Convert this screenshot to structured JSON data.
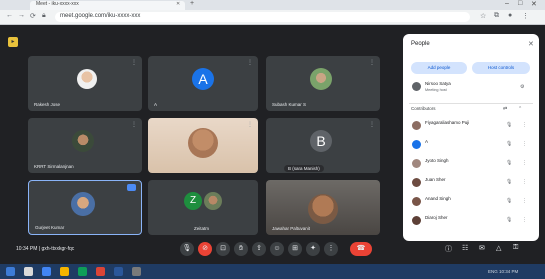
{
  "browser": {
    "tab_title": "Meet - iku-xxxx-xxx",
    "url": "meet.google.com/iku-xxxx-xxx"
  },
  "tiles": [
    {
      "name": "Rakesh Jose"
    },
    {
      "name": "A",
      "letter": "A"
    },
    {
      "name": "Subash Kumar S"
    },
    {
      "name": "KRRT Sirmalanjnan"
    },
    {
      "name": ""
    },
    {
      "name": "",
      "letter": "B"
    },
    {
      "name": "Gurjeet Kumar",
      "pinned": true
    },
    {
      "name": "Zeitatm",
      "letter": "Z"
    },
    {
      "name": "Jawahar Paltuvanit"
    }
  ],
  "camera_pill": "B (sara Manish)",
  "footer": {
    "time": "10:34 PM",
    "separator": "|",
    "meeting_code": "gxh-ttxxkgr-fqc"
  },
  "people_panel": {
    "title": "People",
    "add_people": "Add people",
    "host_controls": "Host controls",
    "section": "Contributors",
    "host": {
      "name": "Nirsoo Satya",
      "sub": "Meeting host"
    },
    "rows": [
      {
        "name": "Fiyagaraliashamo Puji",
        "sub": "",
        "color": "#8d6e63"
      },
      {
        "name": "A",
        "sub": "",
        "color": "#1a73e8"
      },
      {
        "name": "Jyoto Singh",
        "sub": "",
        "color": "#a1887f"
      },
      {
        "name": "Juan Sher",
        "sub": "",
        "color": "#6d4c41"
      },
      {
        "name": "Anand Singh",
        "sub": "",
        "color": "#795548"
      },
      {
        "name": "Diaroj Sher",
        "sub": "",
        "color": "#5d4037"
      }
    ]
  },
  "taskbar": {
    "right_text": "ENG 10:34 PM"
  },
  "colors": {
    "accent": "#1a73e8",
    "hangup": "#ea4335",
    "panel_button": "#d3e3fd"
  }
}
